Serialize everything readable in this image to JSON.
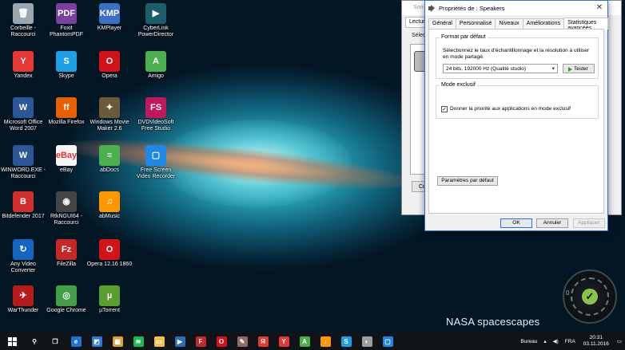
{
  "desktop": {
    "watermark": "NASA spacescapes",
    "icons": [
      {
        "label": "Corbeille - Raccourci",
        "glyph": "🗑",
        "color": "#9aa7b0"
      },
      {
        "label": "Foxit PhantomPDF",
        "glyph": "PDF",
        "color": "#7b3fa0"
      },
      {
        "label": "KMPlayer",
        "glyph": "KMP",
        "color": "#3a6fc4"
      },
      {
        "label": "CyberLink PowerDirector",
        "glyph": "▶",
        "color": "#1d5d6b"
      },
      {
        "label": "Yandex",
        "glyph": "Y",
        "color": "#e53935"
      },
      {
        "label": "Skype",
        "glyph": "S",
        "color": "#1ea0e6"
      },
      {
        "label": "Opera",
        "glyph": "O",
        "color": "#d3121c"
      },
      {
        "label": "Amigo",
        "glyph": "A",
        "color": "#4caf50"
      },
      {
        "label": "Microsoft Office Word 2007",
        "glyph": "W",
        "color": "#2b5797"
      },
      {
        "label": "Mozilla Firefox",
        "glyph": "ff",
        "color": "#e66000"
      },
      {
        "label": "Windows Movie Maker 2.6",
        "glyph": "✦",
        "color": "#6a5a3a"
      },
      {
        "label": "DVDVideoSoft Free Studio",
        "glyph": "FS",
        "color": "#c2185b"
      },
      {
        "label": "WINWORD.EXE - Raccourci",
        "glyph": "W",
        "color": "#2b5797"
      },
      {
        "label": "eBay",
        "glyph": "eBay",
        "color": "#f5f5f5"
      },
      {
        "label": "abDocs",
        "glyph": "≡",
        "color": "#4caf50"
      },
      {
        "label": "Free Screen Video Recorder",
        "glyph": "▢",
        "color": "#1e88e5"
      },
      {
        "label": "Bitdefender 2017",
        "glyph": "B",
        "color": "#d32f2f"
      },
      {
        "label": "RtkNGUI64 - Raccourci",
        "glyph": "◉",
        "color": "#444444"
      },
      {
        "label": "abMusic",
        "glyph": "♫",
        "color": "#ff9800"
      },
      {
        "label": "Any Video Converter",
        "glyph": "↻",
        "color": "#1565c0"
      },
      {
        "label": "FileZilla",
        "glyph": "Fz",
        "color": "#c62828"
      },
      {
        "label": "Opera 12.16 1860",
        "glyph": "O",
        "color": "#d3121c"
      },
      {
        "label": "WarThunder",
        "glyph": "✈",
        "color": "#b71c1c"
      },
      {
        "label": "Google Chrome",
        "glyph": "◎",
        "color": "#43a047"
      },
      {
        "label": "µTorrent",
        "glyph": "µ",
        "color": "#5a9e2f"
      }
    ]
  },
  "gauge": {
    "value": "0"
  },
  "back_window": {
    "title": "Son",
    "tab": "Lecture",
    "select_label": "Sélect",
    "button_label": "Co"
  },
  "dialog": {
    "title": "Propriétés de : Speakers",
    "close": "✕",
    "tabs": [
      "Général",
      "Personnalisé",
      "Niveaux",
      "Améliorations",
      "Statistiques avancées"
    ],
    "active_tab": 4,
    "format_group": {
      "title": "Format par défaut",
      "description": "Sélectionnez le taux d'échantillonnage et la résolution à utiliser en mode partagé.",
      "selected_format": "24 bits, 192000 Hz (Qualité studio)",
      "test_button": "Tester"
    },
    "exclusive_group": {
      "title": "Mode exclusif",
      "checkbox_label": "Donner la priorité aux applications en mode exclusif",
      "checked": true
    },
    "default_button": "Paramètres par défaut",
    "ok_button": "OK",
    "cancel_button": "Annuler",
    "apply_button": "Appliquer"
  },
  "taskbar": {
    "apps": [
      {
        "name": "search-icon",
        "glyph": "⚲",
        "color": "#101418"
      },
      {
        "name": "task-view-icon",
        "glyph": "❐",
        "color": "#101418"
      },
      {
        "name": "edge-icon",
        "glyph": "e",
        "color": "#1e73d2"
      },
      {
        "name": "store-icon",
        "glyph": "◩",
        "color": "#2f7ad6"
      },
      {
        "name": "app-icon",
        "glyph": "▦",
        "color": "#e0a030"
      },
      {
        "name": "spotify-icon",
        "glyph": "≋",
        "color": "#1db954"
      },
      {
        "name": "explorer-icon",
        "glyph": "▭",
        "color": "#f2c14e"
      },
      {
        "name": "media-icon",
        "glyph": "▶",
        "color": "#2b6fb5"
      },
      {
        "name": "filezilla-icon",
        "glyph": "F",
        "color": "#c62828"
      },
      {
        "name": "opera-icon",
        "glyph": "O",
        "color": "#d3121c"
      },
      {
        "name": "paint-icon",
        "glyph": "✎",
        "color": "#8d6e63"
      },
      {
        "name": "yandex-icon",
        "glyph": "Я",
        "color": "#e53935"
      },
      {
        "name": "yandex-browser-icon",
        "glyph": "Y",
        "color": "#e53935"
      },
      {
        "name": "amigo-icon",
        "glyph": "A",
        "color": "#4caf50"
      },
      {
        "name": "music-icon",
        "glyph": "♪",
        "color": "#ff9800"
      },
      {
        "name": "skype-icon",
        "glyph": "S",
        "color": "#1ea0e6"
      },
      {
        "name": "speaker-app-icon",
        "glyph": "◐",
        "color": "#9e9e9e"
      },
      {
        "name": "screen-recorder-icon",
        "glyph": "▢",
        "color": "#1e88e5"
      }
    ],
    "tray": {
      "label": "Bureau",
      "lang": "FRA",
      "time": "20:31",
      "date": "03.11.2016"
    }
  }
}
